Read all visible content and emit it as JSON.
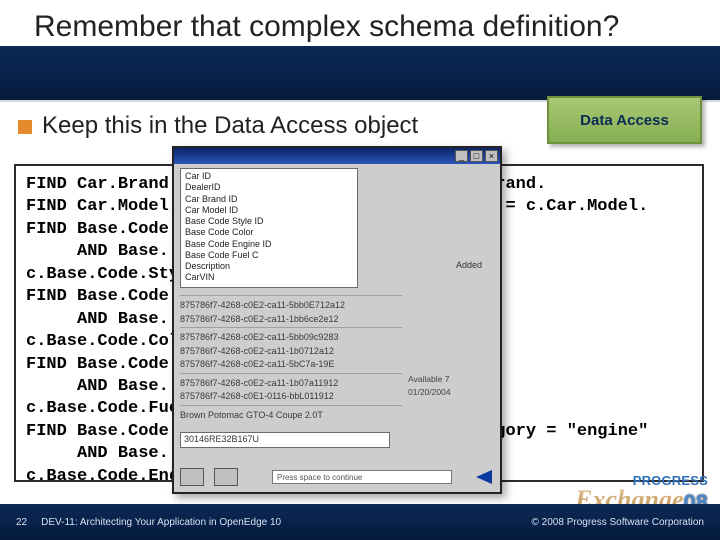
{
  "title": "Remember that complex schema definition?",
  "bullet": "Keep this in the Data Access object",
  "data_access_box": "Data Access",
  "code_lines": [
    "FIND Car.Brand                             r.Brand.",
    "FIND Car.Model                             ame = c.Car.Model.",
    "FIND Base.Code",
    "     AND Base.                             le.",
    "c.Base.Code.Styl                           .",
    "FIND Base.Code",
    "     AND Base.                             or.",
    "c.Base.Code.Colo                           .",
    "FIND Base.Code",
    "     AND Base.                             l.",
    "c.Base.Code.Fuel                           .",
    "FIND Base.Code                             ategory = \"engine\"",
    "     AND Base.                             ine.",
    "c.Base.Code.Engi                           D."
  ],
  "popup": {
    "fields": [
      "Car ID",
      "DealerID",
      "Car Brand ID",
      "Car Model ID",
      "Base Code Style ID",
      "Base Code Color",
      "Base Code Engine ID",
      "Base Code Fuel C",
      "Description",
      "CarVIN"
    ],
    "added_label": "Added",
    "ids": [
      "875786f7-4268-c0E2-ca11-5bb0E712a12",
      "875786f7-4268-c0E2-ca11-1bb6ce2e12",
      "875786f7-4268-c0E2-ca11-5bb09c9283",
      "875786f7-4268-c0E2-ca11-1b0712a12",
      "875786f7-4268-c0E2-ca11-5bC7a-19E",
      "875786f7-4268-c0E2-ca11-1b07a11912",
      "875786f7-4268-c0E1-0116-bbL011912"
    ],
    "item_detail": "Brown Potomac GTO-4 Coupe 2.0T",
    "side_labels": [
      "Available 7",
      "01/20/2004"
    ],
    "vin": "30146RE32B167U",
    "progress_text": "Press space to continue"
  },
  "footer": {
    "page": "22",
    "session": "DEV-11: Architecting Your Application in OpenEdge 10",
    "copyright": "© 2008 Progress Software Corporation",
    "logo_top": "PROGRESS",
    "logo_main": "Exchange",
    "logo_year": "08"
  }
}
